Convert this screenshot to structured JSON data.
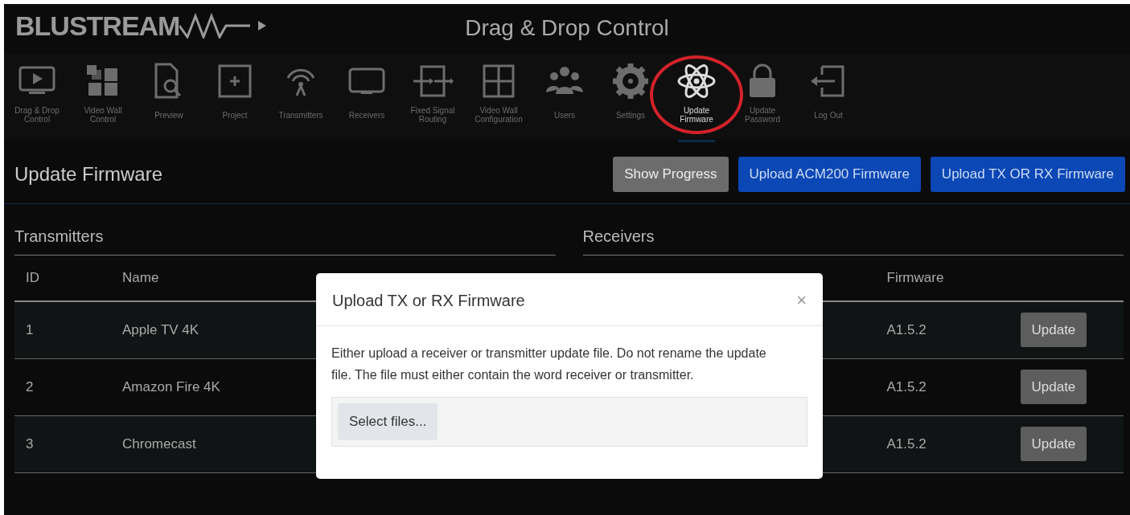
{
  "header": {
    "logo": "BLUSTREAM",
    "title": "Drag & Drop Control"
  },
  "nav": [
    {
      "label": "Drag & Drop Control",
      "selected": false,
      "circled": false
    },
    {
      "label": "Video Wall Control",
      "selected": false,
      "circled": false
    },
    {
      "label": "Preview",
      "selected": false,
      "circled": false
    },
    {
      "label": "Project",
      "selected": false,
      "circled": false
    },
    {
      "label": "Transmitters",
      "selected": false,
      "circled": false
    },
    {
      "label": "Receivers",
      "selected": false,
      "circled": false
    },
    {
      "label": "Fixed Signal Routing",
      "selected": false,
      "circled": false
    },
    {
      "label": "Video Wall Configuration",
      "selected": false,
      "circled": false
    },
    {
      "label": "Users",
      "selected": false,
      "circled": false
    },
    {
      "label": "Settings",
      "selected": false,
      "circled": false
    },
    {
      "label": "Update Firmware",
      "selected": true,
      "circled": true
    },
    {
      "label": "Update Password",
      "selected": false,
      "circled": false
    },
    {
      "label": "Log Out",
      "selected": false,
      "circled": false
    }
  ],
  "page": {
    "title": "Update Firmware",
    "buttons": [
      {
        "label": "Show Progress",
        "kind": "secondary"
      },
      {
        "label": "Upload ACM200 Firmware",
        "kind": "primary"
      },
      {
        "label": "Upload TX OR RX Firmware",
        "kind": "primary"
      }
    ]
  },
  "transmitters": {
    "title": "Transmitters",
    "columns": [
      "ID",
      "Name"
    ],
    "rows": [
      {
        "id": "1",
        "name": "Apple TV 4K"
      },
      {
        "id": "2",
        "name": "Amazon Fire 4K"
      },
      {
        "id": "3",
        "name": "Chromecast"
      }
    ]
  },
  "receivers": {
    "title": "Receivers",
    "column_3": "Firmware",
    "rows": [
      {
        "firmware": "A1.5.2",
        "action": "Update"
      },
      {
        "firmware": "A1.5.2",
        "action": "Update"
      },
      {
        "firmware": "A1.5.2",
        "action": "Update"
      }
    ]
  },
  "modal": {
    "title": "Upload TX or RX Firmware",
    "close": "×",
    "text": "Either upload a receiver or transmitter update file. Do not rename the update file. The file must either contain the word receiver or transmitter.",
    "file_button": "Select files..."
  }
}
